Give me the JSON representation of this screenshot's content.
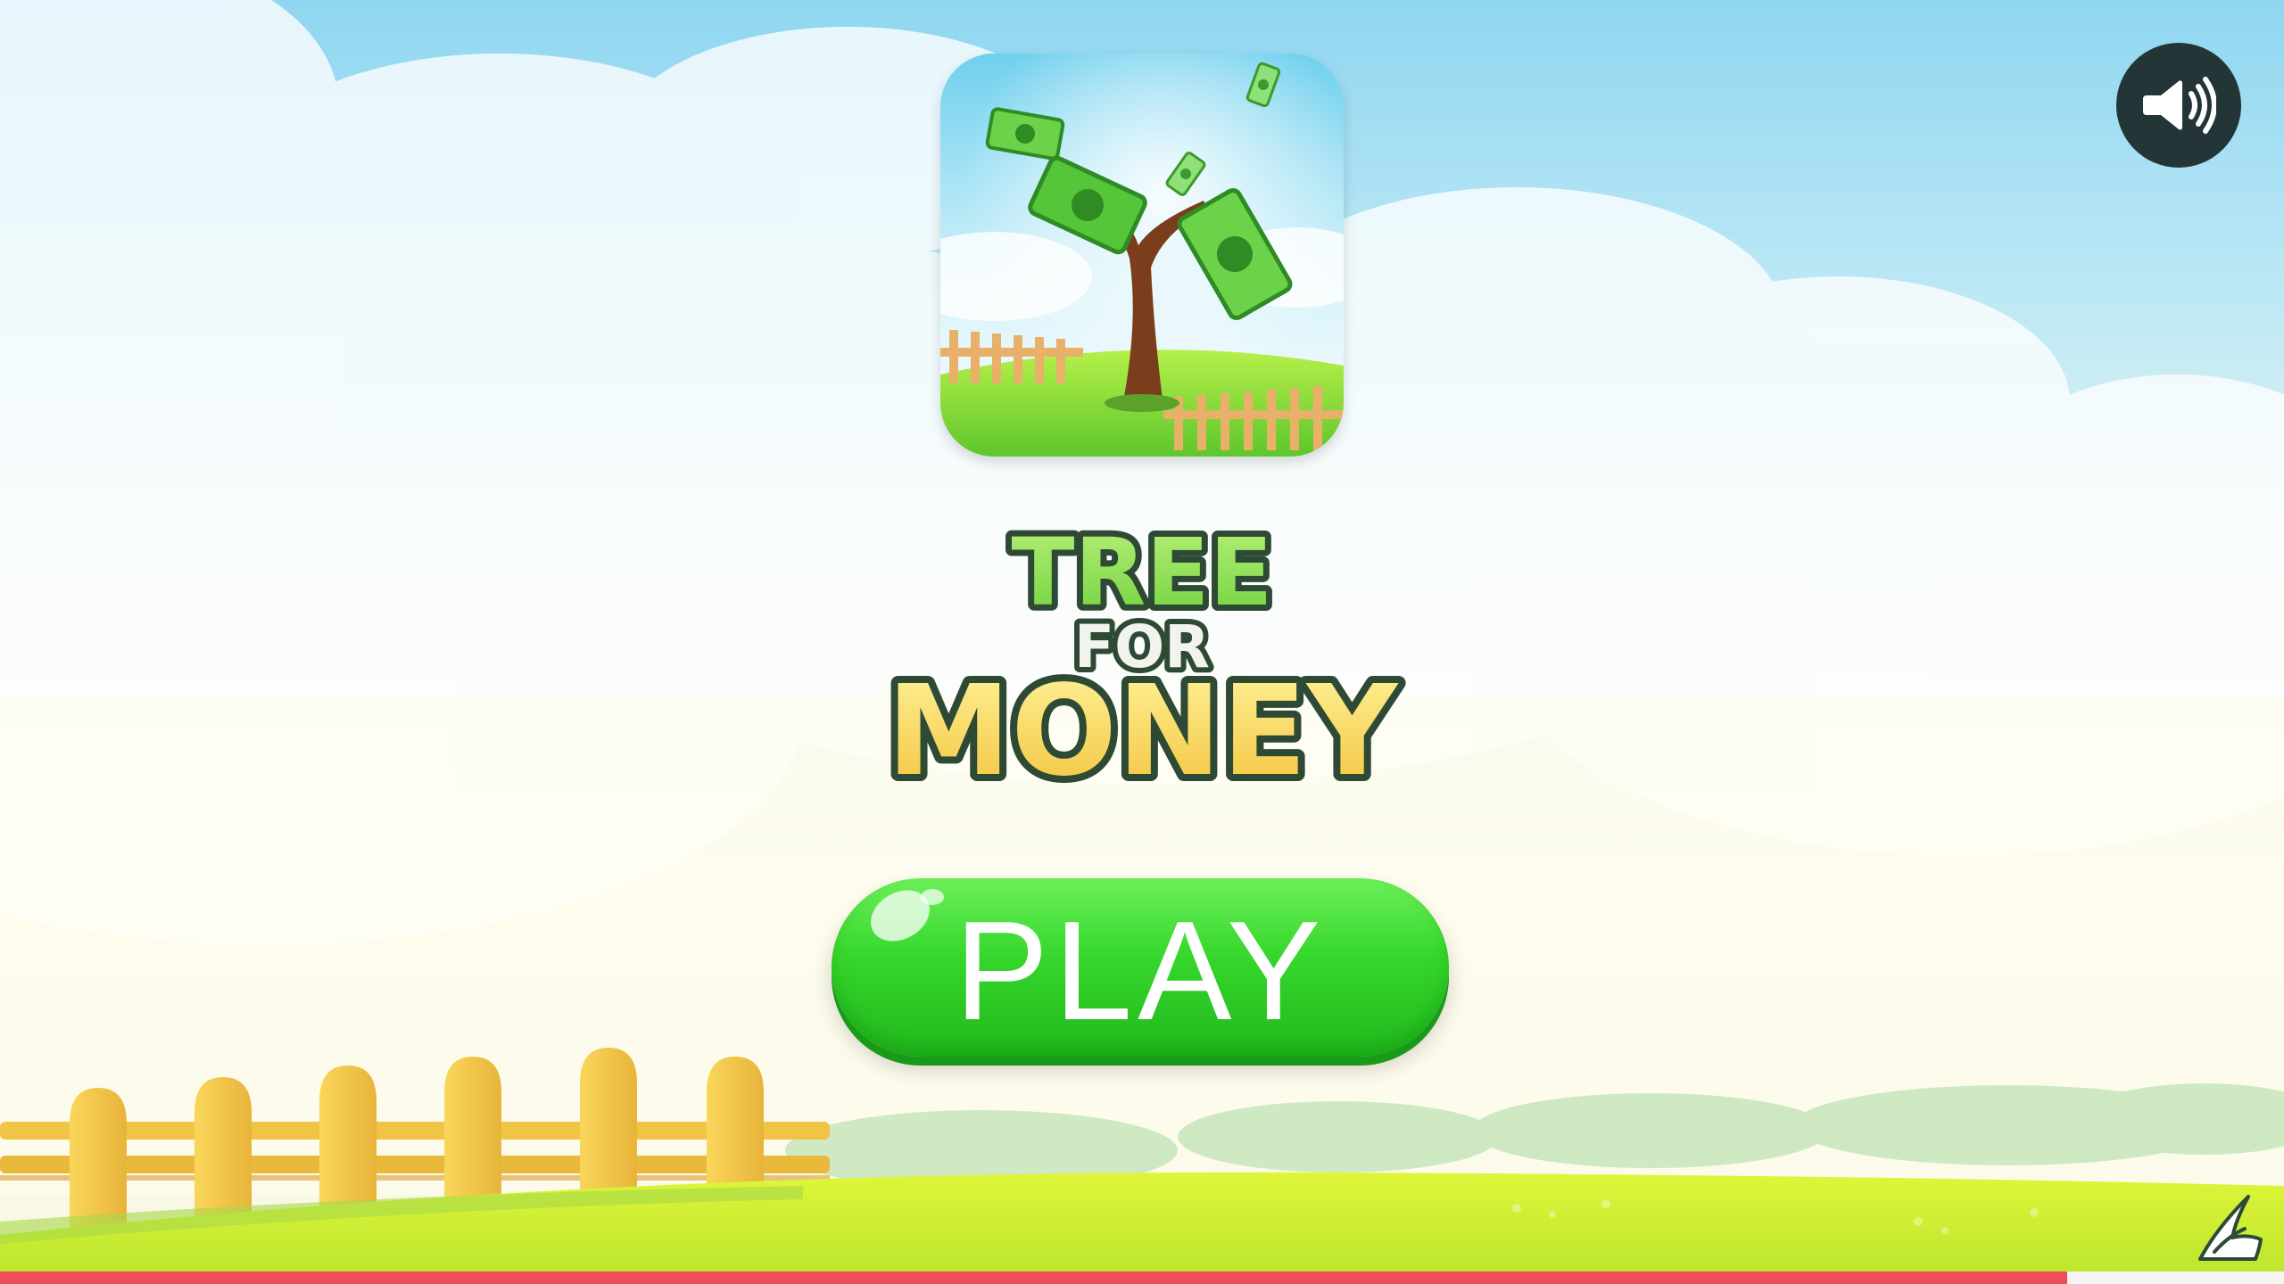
{
  "game": {
    "title_line1": "TREE",
    "title_line2": "FOR",
    "title_line3": "MONEY",
    "play_label": "PLAY"
  },
  "icons": {
    "app_icon": "money-tree-icon",
    "sound": "speaker-volume-icon",
    "brand": "publisher-logo-icon"
  },
  "loading_progress": 0.905,
  "colors": {
    "play_green": "#35d62b",
    "title_green": "#8ee05a",
    "title_yellow": "#f7d04a",
    "title_outline": "#2e4a34",
    "sound_bg": "#233536",
    "progress_red": "#ef4c5c",
    "grass": "#c9ee3a"
  }
}
